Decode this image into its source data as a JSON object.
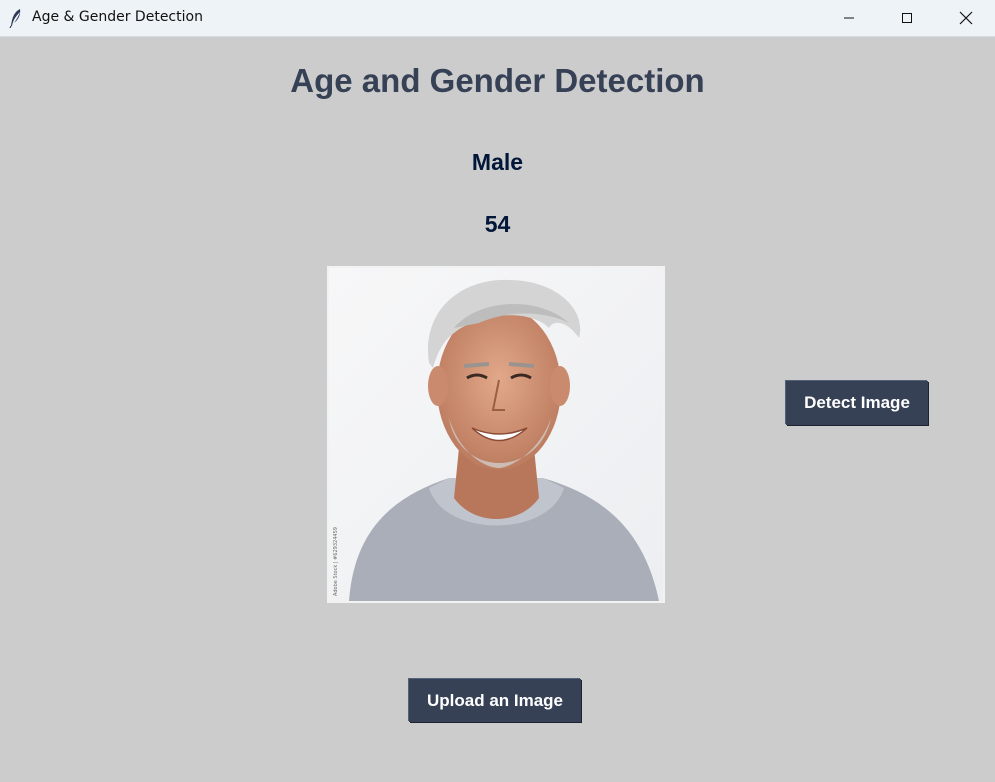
{
  "window": {
    "title": "Age & Gender Detection",
    "icon": "feather-icon",
    "controls": [
      "minimize-icon",
      "maximize-icon",
      "close-icon"
    ]
  },
  "heading": "Age and Gender Detection",
  "result": {
    "gender": "Male",
    "age": "54"
  },
  "photo": {
    "description_icon": "portrait-image",
    "watermark": "Adobe Stock | #629324459"
  },
  "buttons": {
    "detect": "Detect Image",
    "upload": "Upload an Image"
  },
  "colors": {
    "background": "#cccccc",
    "heading": "#364156",
    "result_text": "#011638",
    "button_bg": "#364156",
    "button_text": "#ffffff"
  }
}
